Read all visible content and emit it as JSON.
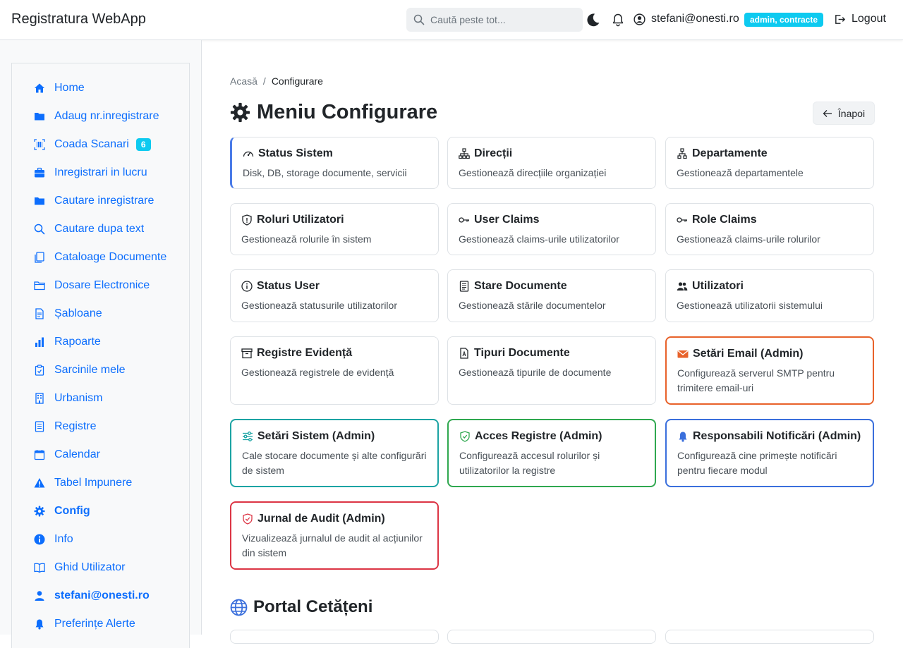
{
  "navbar": {
    "brand": "Registratura WebApp",
    "search_placeholder": "Caută peste tot...",
    "user_email": "stefani@onesti.ro",
    "role_badge": "admin, contracte",
    "logout_label": "Logout"
  },
  "sidebar": {
    "items": [
      {
        "label": "Home",
        "icon": "home-icon"
      },
      {
        "label": "Adaug nr.inregistrare",
        "icon": "folder-icon"
      },
      {
        "label": "Coada Scanari",
        "icon": "barcode-icon",
        "badge": "6"
      },
      {
        "label": "Inregistrari in lucru",
        "icon": "briefcase-icon"
      },
      {
        "label": "Cautare inregistrare",
        "icon": "folder-icon"
      },
      {
        "label": "Cautare dupa text",
        "icon": "search-icon"
      },
      {
        "label": "Cataloage Documente",
        "icon": "files-icon"
      },
      {
        "label": "Dosare Electronice",
        "icon": "folder-outline-icon"
      },
      {
        "label": "Șabloane",
        "icon": "document-icon"
      },
      {
        "label": "Rapoarte",
        "icon": "bar-chart-icon"
      },
      {
        "label": "Sarcinile mele",
        "icon": "clipboard-icon"
      },
      {
        "label": "Urbanism",
        "icon": "building-icon"
      },
      {
        "label": "Registre",
        "icon": "register-icon"
      },
      {
        "label": "Calendar",
        "icon": "calendar-icon"
      },
      {
        "label": "Tabel Impunere",
        "icon": "warning-icon"
      },
      {
        "label": "Config",
        "icon": "gear-icon",
        "active": true
      },
      {
        "label": "Info",
        "icon": "info-icon"
      },
      {
        "label": "Ghid Utilizator",
        "icon": "book-icon"
      },
      {
        "label": "stefani@onesti.ro",
        "icon": "person-icon",
        "bold": true
      },
      {
        "label": "Preferințe Alerte",
        "icon": "bell-icon"
      }
    ]
  },
  "breadcrumb": {
    "home": "Acasă",
    "separator": "/",
    "current": "Configurare"
  },
  "page": {
    "title": "Meniu Configurare",
    "back_label": "Înapoi"
  },
  "cards": [
    {
      "title": "Status Sistem",
      "desc": "Disk, DB, storage documente, servicii",
      "icon": "speedometer-icon"
    },
    {
      "title": "Direcții",
      "desc": "Gestionează direcțiile organizației",
      "icon": "diagram-icon"
    },
    {
      "title": "Departamente",
      "desc": "Gestionează departamentele",
      "icon": "diagram-small-icon"
    },
    {
      "title": "Roluri Utilizatori",
      "desc": "Gestionează rolurile în sistem",
      "icon": "shield-icon"
    },
    {
      "title": "User Claims",
      "desc": "Gestionează claims-urile utilizatorilor",
      "icon": "key-icon"
    },
    {
      "title": "Role Claims",
      "desc": "Gestionează claims-urile rolurilor",
      "icon": "key-icon"
    },
    {
      "title": "Status User",
      "desc": "Gestionează statusurile utilizatorilor",
      "icon": "info-circle-icon"
    },
    {
      "title": "Stare Documente",
      "desc": "Gestionează stările documentelor",
      "icon": "file-text-icon"
    },
    {
      "title": "Utilizatori",
      "desc": "Gestionează utilizatorii sistemului",
      "icon": "people-icon"
    },
    {
      "title": "Registre Evidență",
      "desc": "Gestionează registrele de evidență",
      "icon": "archive-icon"
    },
    {
      "title": "Tipuri Documente",
      "desc": "Gestionează tipurile de documente",
      "icon": "file-pdf-icon"
    },
    {
      "title": "Setări Email (Admin)",
      "desc": "Configurează serverul SMTP pentru trimitere email-uri",
      "icon": "envelope-icon",
      "accent": "#e8622a"
    },
    {
      "title": "Setări Sistem (Admin)",
      "desc": "Cale stocare documente și alte configurări de sistem",
      "icon": "sliders-icon",
      "accent": "#1ba3a3"
    },
    {
      "title": "Acces Registre (Admin)",
      "desc": "Configurează accesul rolurilor și utilizatorilor la registre",
      "icon": "shield-check-icon",
      "accent": "#2fa84f"
    },
    {
      "title": "Responsabili Notificări (Admin)",
      "desc": "Configurează cine primește notificări pentru fiecare modul",
      "icon": "bell-icon",
      "accent": "#3a6fdc"
    },
    {
      "title": "Jurnal de Audit (Admin)",
      "desc": "Vizualizează jurnalul de audit al acțiunilor din sistem",
      "icon": "shield-audit-icon",
      "accent": "#dc3545"
    }
  ],
  "portal_section": {
    "title": "Portal Cetățeni",
    "icon": "globe-icon"
  },
  "colors": {
    "primary": "#0d6efd",
    "info": "#0dcaf0",
    "border": "#dee2e6"
  }
}
